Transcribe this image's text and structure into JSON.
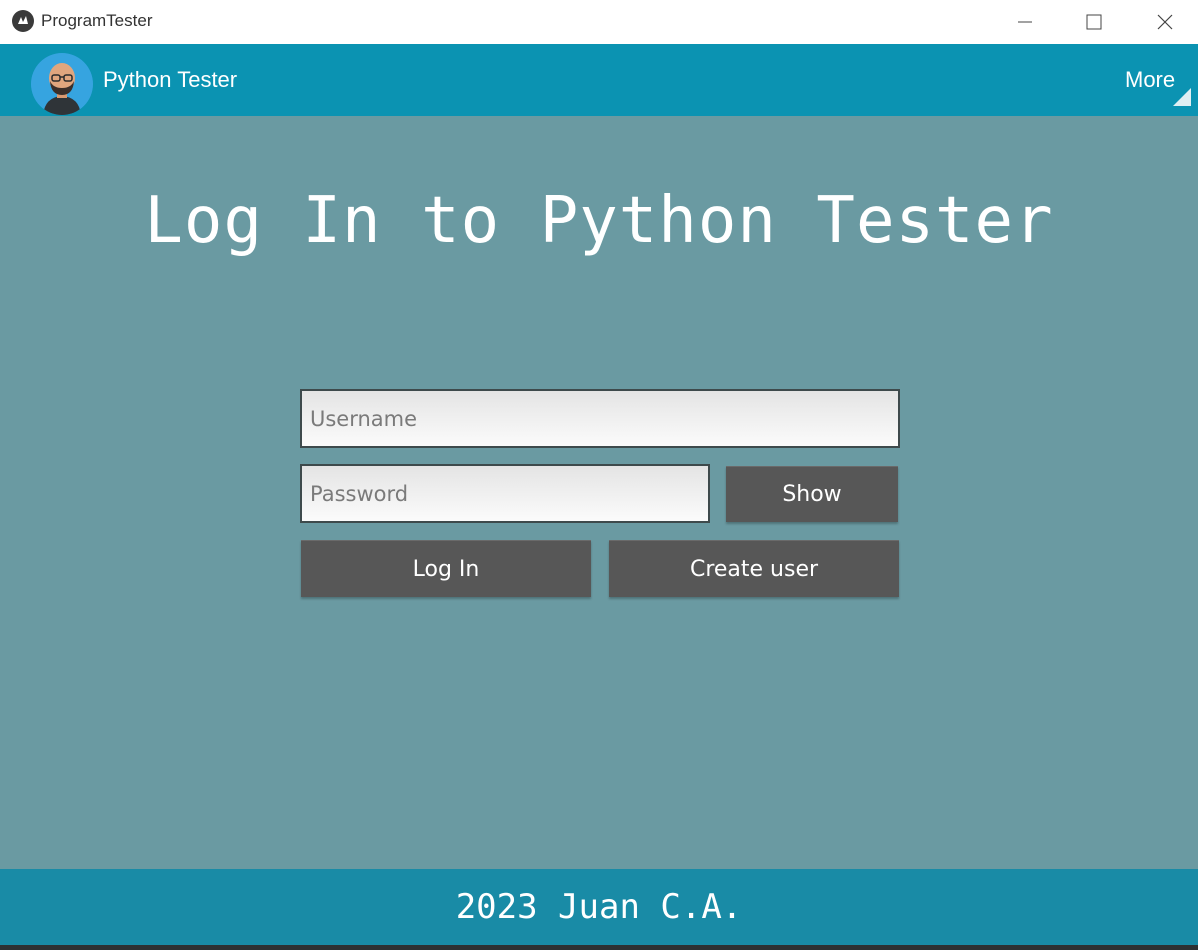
{
  "window": {
    "title": "ProgramTester",
    "icon": "kivy-app-icon",
    "controls": [
      "minimize-icon",
      "maximize-icon",
      "close-icon"
    ]
  },
  "toolbar": {
    "title": "Python Tester",
    "avatar": "user-avatar",
    "more_label": "More",
    "background": "#0b93b2"
  },
  "main": {
    "heading": "Log In to Python Tester",
    "username_placeholder": "Username",
    "password_placeholder": "Password",
    "show_label": "Show",
    "login_label": "Log In",
    "create_label": "Create user",
    "background": "#6a9aa2",
    "button_color": "#575757"
  },
  "footer": {
    "text": "2023 Juan C.A.",
    "background": "#198ba6"
  }
}
